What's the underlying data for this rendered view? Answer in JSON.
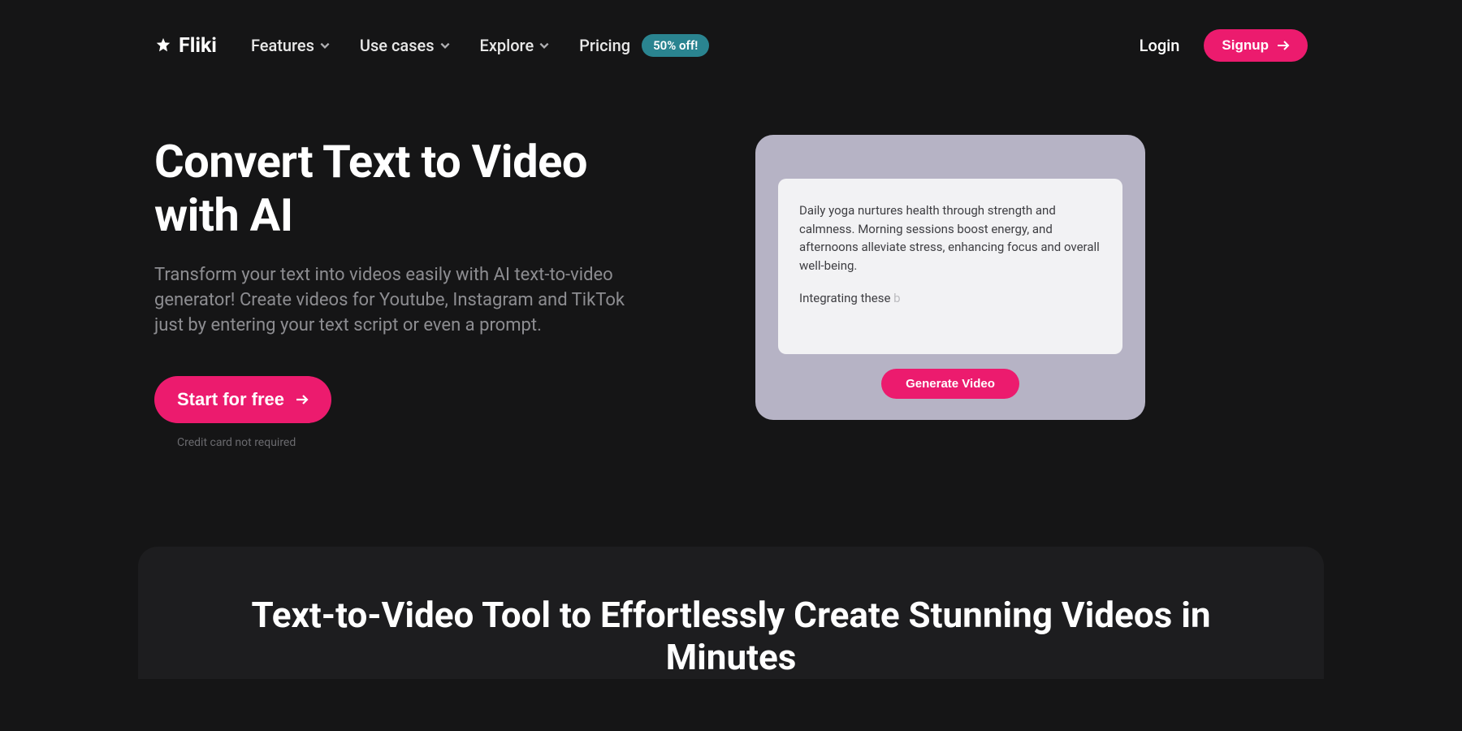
{
  "nav": {
    "brand": "Fliki",
    "items": [
      {
        "label": "Features",
        "hasDropdown": true
      },
      {
        "label": "Use cases",
        "hasDropdown": true
      },
      {
        "label": "Explore",
        "hasDropdown": true
      },
      {
        "label": "Pricing",
        "hasDropdown": false
      }
    ],
    "badge": "50% off!",
    "login": "Login",
    "signup": "Signup"
  },
  "hero": {
    "title": "Convert Text to Video with AI",
    "description": "Transform your text into videos easily with AI text-to-video generator! Create videos for Youtube, Instagram and TikTok just by entering your text script or even a prompt.",
    "cta": "Start for free",
    "ctaNote": "Credit card not required"
  },
  "demo": {
    "para1": "Daily yoga nurtures health through strength and calmness. Morning sessions boost energy, and afternoons alleviate stress, enhancing focus and overall well-being.",
    "para2": "Integrating these ",
    "para2faded": "b",
    "button": "Generate Video"
  },
  "section2": {
    "title": "Text-to-Video Tool to Effortlessly Create Stunning Videos in Minutes"
  }
}
